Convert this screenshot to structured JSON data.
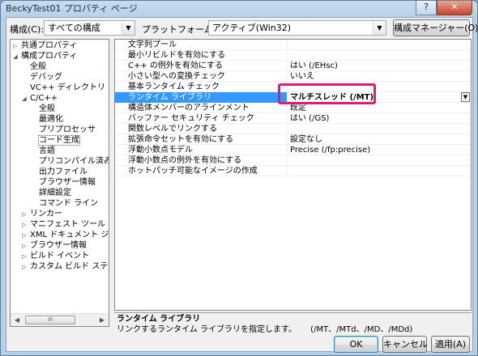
{
  "window": {
    "title": "BeckyTest01 プロパティ ページ",
    "caption_buttons": [
      "?",
      "✕"
    ]
  },
  "config_bar": {
    "config_label": "構成(C):",
    "config_value": "すべての構成",
    "platform_label": "プラットフォーム(P):",
    "platform_value": "アクティブ(Win32)",
    "manager_button": "構成マネージャー(O)..."
  },
  "tree": {
    "items": [
      {
        "label": "共通プロパティ",
        "indent": 0,
        "expander": "▷"
      },
      {
        "label": "構成プロパティ",
        "indent": 0,
        "expander": "◢"
      },
      {
        "label": "全般",
        "indent": 1,
        "expander": ""
      },
      {
        "label": "デバッグ",
        "indent": 1,
        "expander": ""
      },
      {
        "label": "VC++ ディレクトリ",
        "indent": 1,
        "expander": ""
      },
      {
        "label": "C/C++",
        "indent": 1,
        "expander": "◢"
      },
      {
        "label": "全般",
        "indent": 2,
        "expander": ""
      },
      {
        "label": "最適化",
        "indent": 2,
        "expander": ""
      },
      {
        "label": "プリプロセッサ",
        "indent": 2,
        "expander": ""
      },
      {
        "label": "コード生成",
        "indent": 2,
        "expander": "",
        "selected": true
      },
      {
        "label": "言語",
        "indent": 2,
        "expander": ""
      },
      {
        "label": "プリコンパイル済みヘ",
        "indent": 2,
        "expander": ""
      },
      {
        "label": "出力ファイル",
        "indent": 2,
        "expander": ""
      },
      {
        "label": "ブラウザー情報",
        "indent": 2,
        "expander": ""
      },
      {
        "label": "詳細設定",
        "indent": 2,
        "expander": ""
      },
      {
        "label": "コマンド ライン",
        "indent": 2,
        "expander": ""
      },
      {
        "label": "リンカー",
        "indent": 1,
        "expander": "▷"
      },
      {
        "label": "マニフェスト ツール",
        "indent": 1,
        "expander": "▷"
      },
      {
        "label": "XML ドキュメント ジェネ",
        "indent": 1,
        "expander": "▷"
      },
      {
        "label": "ブラウザー情報",
        "indent": 1,
        "expander": "▷"
      },
      {
        "label": "ビルド イベント",
        "indent": 1,
        "expander": "▷"
      },
      {
        "label": "カスタム ビルド ステップ",
        "indent": 1,
        "expander": "▷"
      }
    ],
    "scroll_left": "◀",
    "scroll_right": "▶",
    "thumb_grip": "III"
  },
  "properties": {
    "rows": [
      {
        "name": "文字列プール",
        "value": ""
      },
      {
        "name": "最小リビルドを有効にする",
        "value": ""
      },
      {
        "name": "C++ の例外を有効にする",
        "value": "はい (/EHsc)"
      },
      {
        "name": "小さい型への変換チェック",
        "value": "いいえ"
      },
      {
        "name": "基本ランタイム チェック",
        "value": ""
      },
      {
        "name": "ランタイム ライブラリ",
        "value": "マルチスレッド (/MT)",
        "selected": true
      },
      {
        "name": "構造体メンバーのアラインメント",
        "value": "既定"
      },
      {
        "name": "バッファー セキュリティ チェック",
        "value": "はい (/GS)"
      },
      {
        "name": "関数レベルでリンクする",
        "value": ""
      },
      {
        "name": "拡張命令セットを有効にする",
        "value": "設定なし"
      },
      {
        "name": "浮動小数点モデル",
        "value": "Precise (/fp:precise)"
      },
      {
        "name": "浮動小数点の例外を有効にする",
        "value": ""
      },
      {
        "name": "ホットパッチ可能なイメージの作成",
        "value": ""
      }
    ],
    "dropdown_arrow": "▼"
  },
  "description": {
    "title": "ランタイム ライブラリ",
    "text": "リンクするランタイム ライブラリを指定します。",
    "options": "(/MT、/MTd、/MD、/MDd)"
  },
  "buttons": {
    "ok": "OK",
    "cancel": "キャンセル",
    "apply": "適用(A)"
  },
  "colors": {
    "selection": "#3399ff",
    "highlight_box": "#e0197a"
  }
}
